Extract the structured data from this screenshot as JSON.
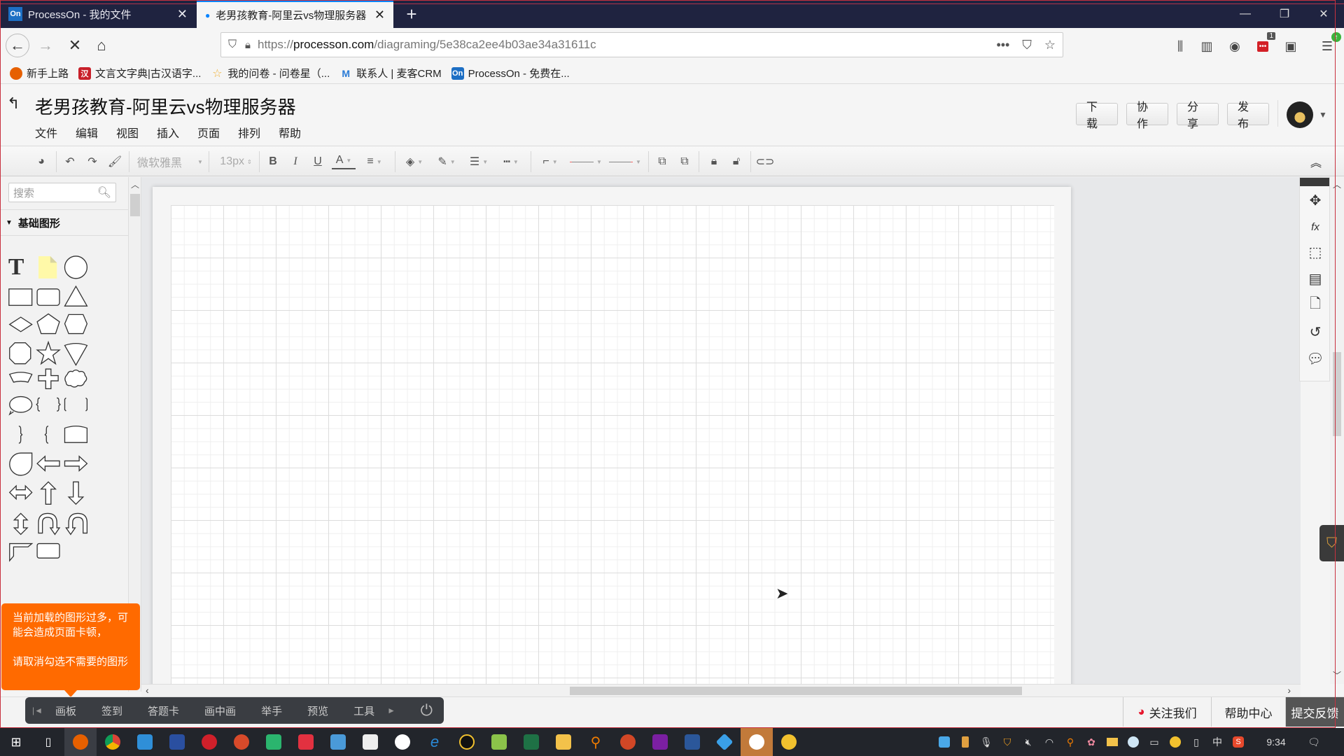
{
  "browser": {
    "tabs": [
      {
        "favicon": "On",
        "title": "ProcessOn - 我的文件",
        "active": false
      },
      {
        "favicon": "dot",
        "title": "老男孩教育-阿里云vs物理服务器",
        "active": true
      }
    ],
    "new_tab": "+",
    "window_controls": {
      "minimize": "—",
      "restore": "❐",
      "close": "✕"
    },
    "nav": {
      "back": "←",
      "forward": "→",
      "stop": "✕",
      "home": "⌂"
    },
    "url": {
      "scheme": "https://",
      "host": "processon.com",
      "path": "/diagraming/5e38ca2ee4b03ae34a31611c"
    },
    "url_tools": {
      "more": "•••",
      "pocket": "⛉",
      "bookmark": "☆"
    },
    "extension_badge": "1",
    "bookmarks": [
      {
        "icon": "firefox-icon",
        "label": "新手上路",
        "color": "#e66000"
      },
      {
        "icon": "han-icon",
        "label": "文言文字典|古汉语字...",
        "color": "#c8202a"
      },
      {
        "icon": "star-icon",
        "label": "我的问卷 - 问卷星（...",
        "color": "#f0b030"
      },
      {
        "icon": "maike-icon",
        "label": "联系人 | 麦客CRM",
        "color": "#2a7bd6"
      },
      {
        "icon": "processon-icon",
        "label": "ProcessOn - 免费在...",
        "color": "#1d6fc4"
      }
    ]
  },
  "app": {
    "back": "↰",
    "doc_title": "老男孩教育-阿里云vs物理服务器",
    "menus": [
      "文件",
      "编辑",
      "视图",
      "插入",
      "页面",
      "排列",
      "帮助"
    ],
    "header_buttons": [
      "下载",
      "协作",
      "分享",
      "发布"
    ],
    "toolbar": {
      "font_family": "微软雅黑",
      "font_size": "13px",
      "bold": "B",
      "italic": "I",
      "underline": "U",
      "font_color": "A"
    },
    "collapse": "︽",
    "sidebar": {
      "search_placeholder": "搜索",
      "section_title": "基础图形",
      "shapes": [
        "text",
        "note",
        "circle",
        "rectangle",
        "rounded-rectangle",
        "triangle",
        "diamond",
        "pentagon",
        "hexagon",
        "octagon",
        "star",
        "inverted-sector",
        "trapezoid-arc",
        "cross",
        "cloud",
        "speech-bubble",
        "braces",
        "brackets",
        "right-brace",
        "left-brace",
        "rounded-top-rectangle",
        "teardrop",
        "left-arrow",
        "right-arrow",
        "double-arrow",
        "up-arrow",
        "down-arrow",
        "up-down-arrow",
        "u-turn-arrow-right",
        "u-turn-arrow-left",
        "corner",
        "rounded-rectangle-small"
      ]
    },
    "warning": {
      "line1": "当前加载的图形过多，可能会造成页面卡顿，",
      "line2": "请取消勾选不需要的图形"
    },
    "live_bar": [
      "画板",
      "签到",
      "答题卡",
      "画中画",
      "举手",
      "预览",
      "工具"
    ],
    "footer": {
      "follow": "关注我们",
      "help": "帮助中心",
      "feedback": "提交反馈"
    }
  },
  "taskbar": {
    "apps": [
      "windows-start",
      "task-view",
      "firefox",
      "chrome",
      "app-blue",
      "save-app",
      "netease-music",
      "app-red-swirl",
      "pycharm",
      "xmind",
      "app-doc",
      "typora",
      "app-dots",
      "ie",
      "qq",
      "app-notepad",
      "excel",
      "file-explorer",
      "search-app",
      "powerpoint",
      "app-purple",
      "word",
      "app-diamond",
      "app-record",
      "app-palette"
    ],
    "tray_ime": "中",
    "clock": "9:34"
  }
}
